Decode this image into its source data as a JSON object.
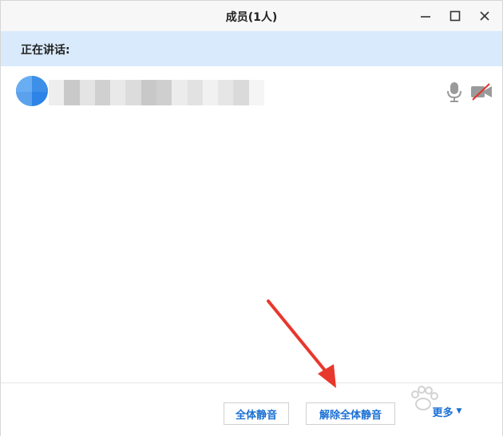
{
  "window": {
    "title": "成员(1人)",
    "controls": [
      "minimize-icon",
      "maximize-icon",
      "close-icon"
    ]
  },
  "speaking": {
    "label": "正在讲话:"
  },
  "members": [
    {
      "name_blurred": true,
      "mic": "mic-icon",
      "camera": "camera-off-icon"
    }
  ],
  "footer": {
    "mute_all_label": "全体静音",
    "unmute_all_label": "解除全体静音",
    "more_label": "更多",
    "more_caret": "▼"
  },
  "colors": {
    "accent": "#1a6fd4",
    "speaking_bar": "#d9eafc",
    "annotation_arrow": "#e8372c",
    "camera_off_slash": "#e0322a"
  }
}
